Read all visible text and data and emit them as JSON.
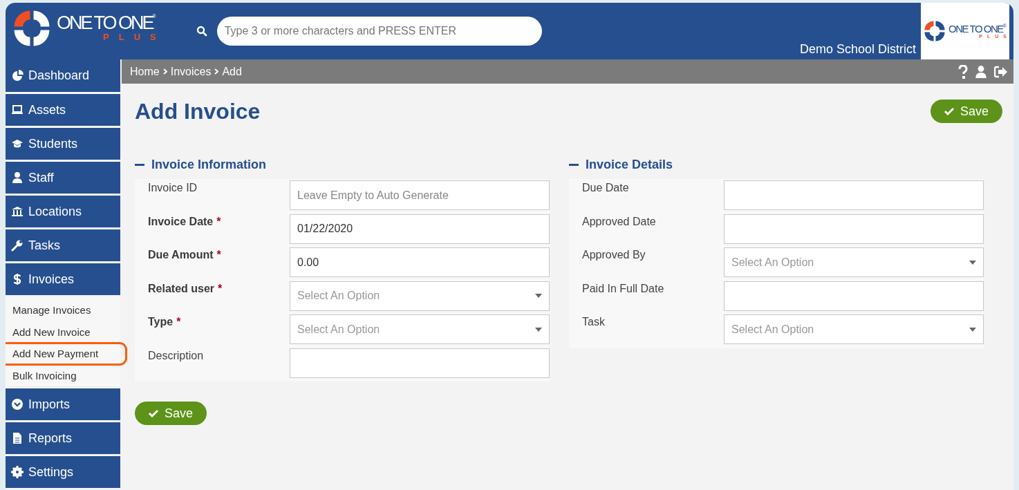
{
  "header": {
    "brand": {
      "name": "ONE TO ONE",
      "mark": "®",
      "sub": "PLUS"
    },
    "search": {
      "placeholder": "Type 3 or more characters and PRESS ENTER"
    },
    "district": "Demo School District",
    "side_logo": {
      "name": "ONE TO ONE",
      "mark": "®",
      "sub": "PLUS"
    }
  },
  "breadcrumb": [
    "Home",
    "Invoices",
    "Add"
  ],
  "sidebar": {
    "items": [
      {
        "label": "Dashboard"
      },
      {
        "label": "Assets"
      },
      {
        "label": "Students"
      },
      {
        "label": "Staff"
      },
      {
        "label": "Locations"
      },
      {
        "label": "Tasks"
      },
      {
        "label": "Invoices",
        "expanded": true,
        "children": [
          {
            "label": "Manage Invoices",
            "highlighted": false
          },
          {
            "label": "Add New Invoice",
            "highlighted": false
          },
          {
            "label": "Add New Payment",
            "highlighted": true
          },
          {
            "label": "Bulk Invoicing",
            "highlighted": false
          }
        ]
      },
      {
        "label": "Imports"
      },
      {
        "label": "Reports"
      },
      {
        "label": "Settings"
      }
    ]
  },
  "page": {
    "title": "Add Invoice",
    "save_top": "Save",
    "save_bottom": "Save",
    "sections": [
      {
        "title": "Invoice Information",
        "expanded": true,
        "fields": [
          {
            "label": "Invoice ID",
            "required": false,
            "kind": "text",
            "placeholder": "Leave Empty to Auto Generate"
          },
          {
            "label": "Invoice Date",
            "required": true,
            "required_mark": "*",
            "kind": "text",
            "value": "01/22/2020"
          },
          {
            "label": "Due Amount",
            "required": true,
            "required_mark": "*",
            "kind": "text",
            "value": "0.00"
          },
          {
            "label": "Related user",
            "required": true,
            "required_mark": "*",
            "kind": "select",
            "placeholder": "Select An Option"
          },
          {
            "label": "Type",
            "required": true,
            "required_mark": "*",
            "kind": "select",
            "placeholder": "Select An Option"
          },
          {
            "label": "Description",
            "required": false,
            "kind": "text"
          }
        ]
      },
      {
        "title": "Invoice Details",
        "expanded": true,
        "fields": [
          {
            "label": "Due Date",
            "required": false,
            "kind": "text"
          },
          {
            "label": "Approved Date",
            "required": false,
            "kind": "text"
          },
          {
            "label": "Approved By",
            "required": false,
            "kind": "select",
            "placeholder": "Select An Option"
          },
          {
            "label": "Paid In Full Date",
            "required": false,
            "kind": "text"
          },
          {
            "label": "Task",
            "required": false,
            "kind": "select",
            "placeholder": "Select An Option"
          }
        ]
      }
    ]
  }
}
